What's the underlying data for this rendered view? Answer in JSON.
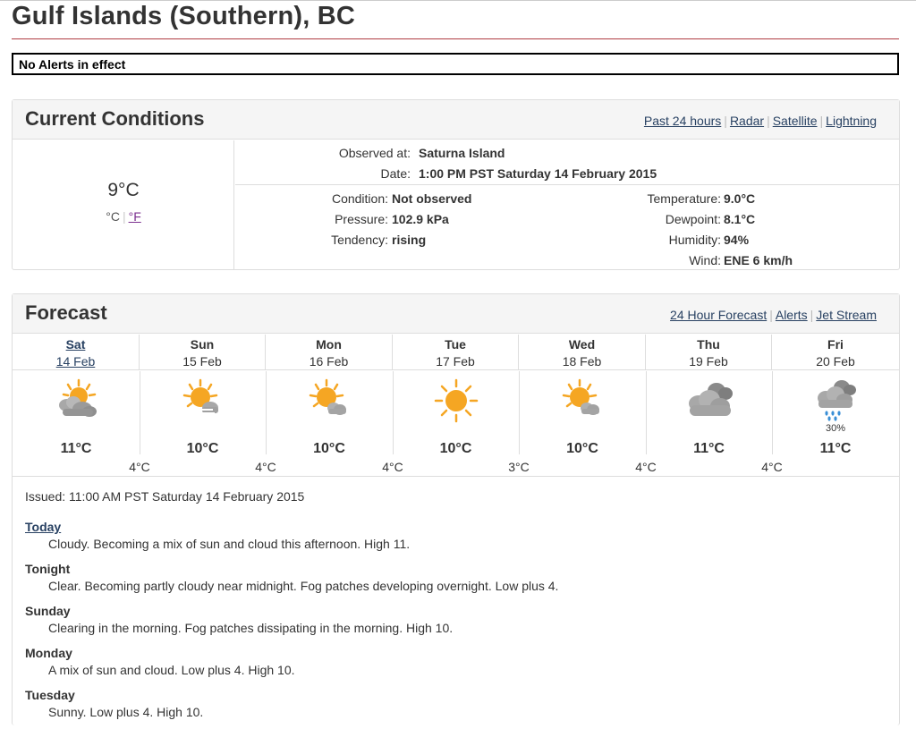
{
  "page": {
    "title": "Gulf Islands (Southern), BC",
    "alert_banner": "No Alerts in effect"
  },
  "current_conditions": {
    "heading": "Current Conditions",
    "links": [
      "Past 24 hours",
      "Radar",
      "Satellite",
      "Lightning"
    ],
    "temperature_big": "9°C",
    "unit_c": "°C",
    "unit_f": "°F",
    "observed_at_label": "Observed at:",
    "observed_at_value": "Saturna Island",
    "date_label": "Date:",
    "date_value": "1:00 PM PST Saturday 14 February 2015",
    "condition_label": "Condition:",
    "condition_value": "Not observed",
    "pressure_label": "Pressure:",
    "pressure_value": "102.9 kPa",
    "tendency_label": "Tendency:",
    "tendency_value": "rising",
    "temperature_label": "Temperature:",
    "temperature_value": "9.0°C",
    "dewpoint_label": "Dewpoint:",
    "dewpoint_value": "8.1°C",
    "humidity_label": "Humidity:",
    "humidity_value": "94%",
    "wind_label": "Wind:",
    "wind_value": "ENE 6 km/h"
  },
  "forecast": {
    "heading": "Forecast",
    "links": [
      "24 Hour Forecast",
      "Alerts",
      "Jet Stream"
    ],
    "days": [
      {
        "name": "Sat",
        "date": "14 Feb",
        "icon": "sun-cloud-icon",
        "high": "11°C",
        "pop": ""
      },
      {
        "name": "Sun",
        "date": "15 Feb",
        "icon": "sun-fog-icon",
        "high": "10°C",
        "pop": ""
      },
      {
        "name": "Mon",
        "date": "16 Feb",
        "icon": "sun-small-cloud-icon",
        "high": "10°C",
        "pop": ""
      },
      {
        "name": "Tue",
        "date": "17 Feb",
        "icon": "sun-icon",
        "high": "10°C",
        "pop": ""
      },
      {
        "name": "Wed",
        "date": "18 Feb",
        "icon": "sun-small-cloud-icon",
        "high": "10°C",
        "pop": ""
      },
      {
        "name": "Thu",
        "date": "19 Feb",
        "icon": "cloud-icon",
        "high": "11°C",
        "pop": ""
      },
      {
        "name": "Fri",
        "date": "20 Feb",
        "icon": "rain-cloud-icon",
        "high": "11°C",
        "pop": "30%"
      }
    ],
    "lows": [
      "4°C",
      "4°C",
      "4°C",
      "3°C",
      "4°C",
      "4°C"
    ],
    "issued": "Issued: 11:00 AM PST Saturday 14 February 2015",
    "periods": [
      {
        "name": "Today",
        "text": "Cloudy. Becoming a mix of sun and cloud this afternoon. High 11."
      },
      {
        "name": "Tonight",
        "text": "Clear. Becoming partly cloudy near midnight. Fog patches developing overnight. Low plus 4."
      },
      {
        "name": "Sunday",
        "text": "Clearing in the morning. Fog patches dissipating in the morning. High 10."
      },
      {
        "name": "Monday",
        "text": "A mix of sun and cloud. Low plus 4. High 10."
      },
      {
        "name": "Tuesday",
        "text": "Sunny. Low plus 4. High 10."
      }
    ]
  },
  "colors": {
    "title_rule": "#af3c43",
    "link": "#284162",
    "sun": "#f5a623",
    "cloud": "#9e9e9e",
    "rain": "#3a8fd6"
  }
}
